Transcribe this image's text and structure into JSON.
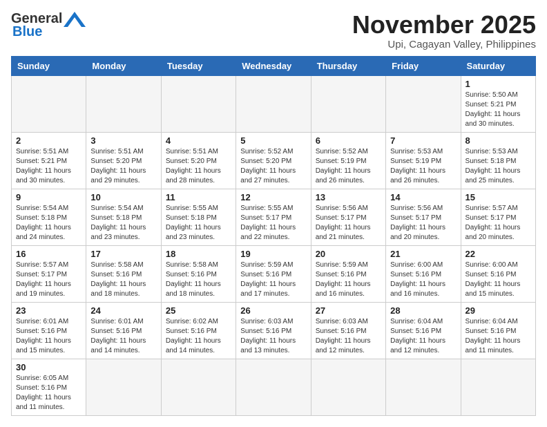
{
  "header": {
    "logo_line1": "General",
    "logo_line2": "Blue",
    "month_title": "November 2025",
    "location": "Upi, Cagayan Valley, Philippines"
  },
  "weekdays": [
    "Sunday",
    "Monday",
    "Tuesday",
    "Wednesday",
    "Thursday",
    "Friday",
    "Saturday"
  ],
  "weeks": [
    [
      {
        "day": "",
        "info": ""
      },
      {
        "day": "",
        "info": ""
      },
      {
        "day": "",
        "info": ""
      },
      {
        "day": "",
        "info": ""
      },
      {
        "day": "",
        "info": ""
      },
      {
        "day": "",
        "info": ""
      },
      {
        "day": "1",
        "info": "Sunrise: 5:50 AM\nSunset: 5:21 PM\nDaylight: 11 hours\nand 30 minutes."
      }
    ],
    [
      {
        "day": "2",
        "info": "Sunrise: 5:51 AM\nSunset: 5:21 PM\nDaylight: 11 hours\nand 30 minutes."
      },
      {
        "day": "3",
        "info": "Sunrise: 5:51 AM\nSunset: 5:20 PM\nDaylight: 11 hours\nand 29 minutes."
      },
      {
        "day": "4",
        "info": "Sunrise: 5:51 AM\nSunset: 5:20 PM\nDaylight: 11 hours\nand 28 minutes."
      },
      {
        "day": "5",
        "info": "Sunrise: 5:52 AM\nSunset: 5:20 PM\nDaylight: 11 hours\nand 27 minutes."
      },
      {
        "day": "6",
        "info": "Sunrise: 5:52 AM\nSunset: 5:19 PM\nDaylight: 11 hours\nand 26 minutes."
      },
      {
        "day": "7",
        "info": "Sunrise: 5:53 AM\nSunset: 5:19 PM\nDaylight: 11 hours\nand 26 minutes."
      },
      {
        "day": "8",
        "info": "Sunrise: 5:53 AM\nSunset: 5:18 PM\nDaylight: 11 hours\nand 25 minutes."
      }
    ],
    [
      {
        "day": "9",
        "info": "Sunrise: 5:54 AM\nSunset: 5:18 PM\nDaylight: 11 hours\nand 24 minutes."
      },
      {
        "day": "10",
        "info": "Sunrise: 5:54 AM\nSunset: 5:18 PM\nDaylight: 11 hours\nand 23 minutes."
      },
      {
        "day": "11",
        "info": "Sunrise: 5:55 AM\nSunset: 5:18 PM\nDaylight: 11 hours\nand 23 minutes."
      },
      {
        "day": "12",
        "info": "Sunrise: 5:55 AM\nSunset: 5:17 PM\nDaylight: 11 hours\nand 22 minutes."
      },
      {
        "day": "13",
        "info": "Sunrise: 5:56 AM\nSunset: 5:17 PM\nDaylight: 11 hours\nand 21 minutes."
      },
      {
        "day": "14",
        "info": "Sunrise: 5:56 AM\nSunset: 5:17 PM\nDaylight: 11 hours\nand 20 minutes."
      },
      {
        "day": "15",
        "info": "Sunrise: 5:57 AM\nSunset: 5:17 PM\nDaylight: 11 hours\nand 20 minutes."
      }
    ],
    [
      {
        "day": "16",
        "info": "Sunrise: 5:57 AM\nSunset: 5:17 PM\nDaylight: 11 hours\nand 19 minutes."
      },
      {
        "day": "17",
        "info": "Sunrise: 5:58 AM\nSunset: 5:16 PM\nDaylight: 11 hours\nand 18 minutes."
      },
      {
        "day": "18",
        "info": "Sunrise: 5:58 AM\nSunset: 5:16 PM\nDaylight: 11 hours\nand 18 minutes."
      },
      {
        "day": "19",
        "info": "Sunrise: 5:59 AM\nSunset: 5:16 PM\nDaylight: 11 hours\nand 17 minutes."
      },
      {
        "day": "20",
        "info": "Sunrise: 5:59 AM\nSunset: 5:16 PM\nDaylight: 11 hours\nand 16 minutes."
      },
      {
        "day": "21",
        "info": "Sunrise: 6:00 AM\nSunset: 5:16 PM\nDaylight: 11 hours\nand 16 minutes."
      },
      {
        "day": "22",
        "info": "Sunrise: 6:00 AM\nSunset: 5:16 PM\nDaylight: 11 hours\nand 15 minutes."
      }
    ],
    [
      {
        "day": "23",
        "info": "Sunrise: 6:01 AM\nSunset: 5:16 PM\nDaylight: 11 hours\nand 15 minutes."
      },
      {
        "day": "24",
        "info": "Sunrise: 6:01 AM\nSunset: 5:16 PM\nDaylight: 11 hours\nand 14 minutes."
      },
      {
        "day": "25",
        "info": "Sunrise: 6:02 AM\nSunset: 5:16 PM\nDaylight: 11 hours\nand 14 minutes."
      },
      {
        "day": "26",
        "info": "Sunrise: 6:03 AM\nSunset: 5:16 PM\nDaylight: 11 hours\nand 13 minutes."
      },
      {
        "day": "27",
        "info": "Sunrise: 6:03 AM\nSunset: 5:16 PM\nDaylight: 11 hours\nand 12 minutes."
      },
      {
        "day": "28",
        "info": "Sunrise: 6:04 AM\nSunset: 5:16 PM\nDaylight: 11 hours\nand 12 minutes."
      },
      {
        "day": "29",
        "info": "Sunrise: 6:04 AM\nSunset: 5:16 PM\nDaylight: 11 hours\nand 11 minutes."
      }
    ],
    [
      {
        "day": "30",
        "info": "Sunrise: 6:05 AM\nSunset: 5:16 PM\nDaylight: 11 hours\nand 11 minutes."
      },
      {
        "day": "",
        "info": ""
      },
      {
        "day": "",
        "info": ""
      },
      {
        "day": "",
        "info": ""
      },
      {
        "day": "",
        "info": ""
      },
      {
        "day": "",
        "info": ""
      },
      {
        "day": "",
        "info": ""
      }
    ]
  ]
}
